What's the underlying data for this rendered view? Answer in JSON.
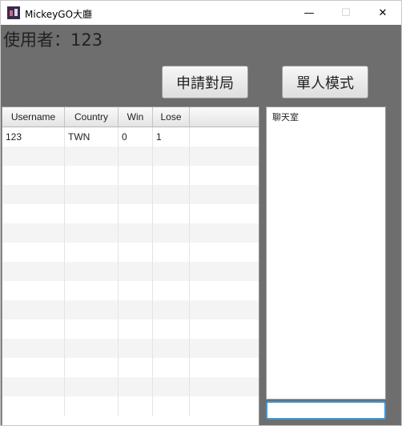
{
  "window": {
    "title": "MickeyGO大廳",
    "icon": "app-icon",
    "min_glyph": "—",
    "max_glyph": "☐",
    "close_glyph": "✕"
  },
  "user": {
    "label": "使用者：123"
  },
  "buttons": {
    "apply_match": "申請對局",
    "single_player": "單人模式"
  },
  "table": {
    "columns": [
      "Username",
      "Country",
      "Win",
      "Lose",
      ""
    ],
    "rows": [
      [
        "123",
        "TWN",
        "0",
        "1",
        ""
      ]
    ]
  },
  "chat": {
    "label": "聊天室",
    "input_value": ""
  },
  "colors": {
    "background": "#6e6e6e",
    "focus": "#3a9ad9"
  }
}
